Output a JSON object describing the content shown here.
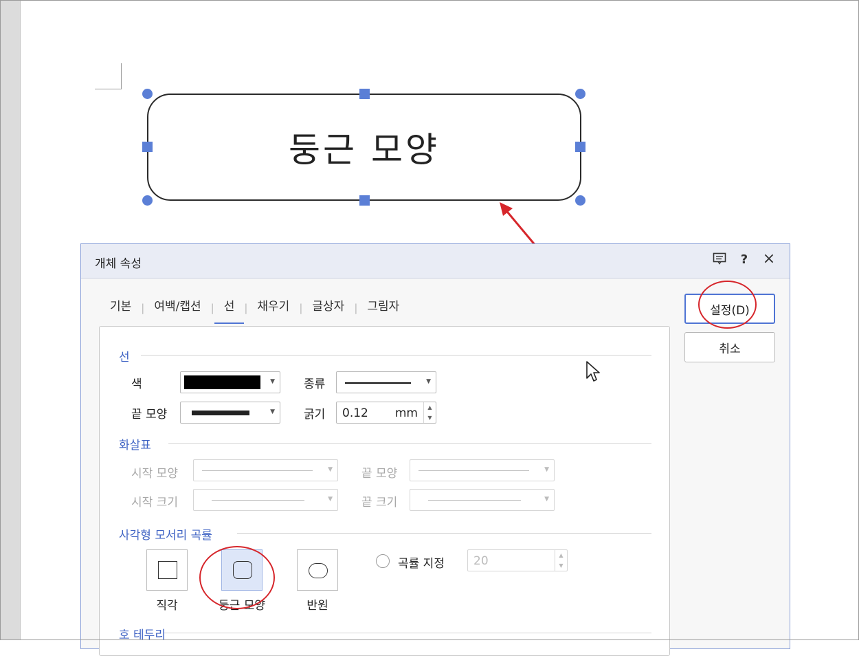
{
  "document": {
    "shape_text": "둥근 모양"
  },
  "dialog": {
    "title": "개체 속성",
    "titlebar_icons": {
      "comment": "comment-icon",
      "help": "?",
      "close": "×"
    },
    "tabs": [
      {
        "label": "기본",
        "active": false
      },
      {
        "label": "여백/캡션",
        "active": false
      },
      {
        "label": "선",
        "active": true
      },
      {
        "label": "채우기",
        "active": false
      },
      {
        "label": "글상자",
        "active": false
      },
      {
        "label": "그림자",
        "active": false
      }
    ],
    "tab_separator": "|",
    "line_section": {
      "title": "선",
      "color_label": "색",
      "color_value": "#000000",
      "type_label": "종류",
      "end_shape_label": "끝 모양",
      "thickness_label": "굵기",
      "thickness_value": "0.12",
      "thickness_unit": "mm"
    },
    "arrow_section": {
      "title": "화살표",
      "start_shape_label": "시작 모양",
      "end_shape_label": "끝 모양",
      "start_size_label": "시작 크기",
      "end_size_label": "끝 크기"
    },
    "corner_section": {
      "title": "사각형 모서리 곡률",
      "options": [
        {
          "label": "직각",
          "selected": false
        },
        {
          "label": "둥근 모양",
          "selected": true
        },
        {
          "label": "반원",
          "selected": false
        }
      ],
      "custom_radio_label": "곡률 지정",
      "custom_value": "20"
    },
    "arc_section": {
      "title": "호 테두리"
    },
    "buttons": {
      "ok": "설정(D)",
      "cancel": "취소"
    }
  },
  "colors": {
    "accent": "#4f74d4",
    "section_title": "#4064c4",
    "handle": "#5b7fd6",
    "annotation": "#d6262b"
  }
}
